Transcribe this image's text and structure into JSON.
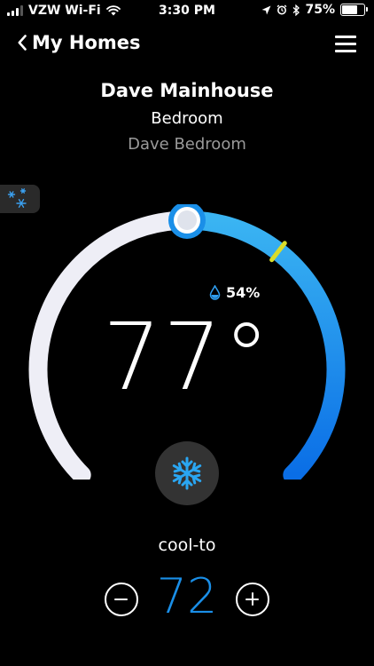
{
  "status_bar": {
    "carrier": "VZW Wi-Fi",
    "time": "3:30 PM",
    "battery": "75%",
    "battery_level": 0.75,
    "icons": [
      "wifi-icon",
      "location-icon",
      "alarm-icon",
      "bluetooth-icon",
      "battery-icon"
    ]
  },
  "nav": {
    "back_label": "My Homes",
    "menu_icon": "hamburger-menu-icon"
  },
  "location": {
    "home": "Dave Mainhouse",
    "room": "Bedroom",
    "device": "Dave Bedroom"
  },
  "mode_tab": {
    "icon": "snowflakes-icon"
  },
  "thermostat": {
    "current_temp": "77°",
    "humidity": "54%",
    "mode_icon": "snowflake-icon",
    "mode_label": "cool-to",
    "setpoint": "72",
    "setpoint_level": 0.5,
    "indicator_level": 0.64
  },
  "colors": {
    "background": "#000000",
    "accent_blue": "#1a8fe8",
    "arc_inactive": "#eeeef6",
    "indicator_yellow": "#d8dc2a",
    "mode_tab_bg": "#2a2a2a",
    "mode_button_bg": "#333333"
  }
}
